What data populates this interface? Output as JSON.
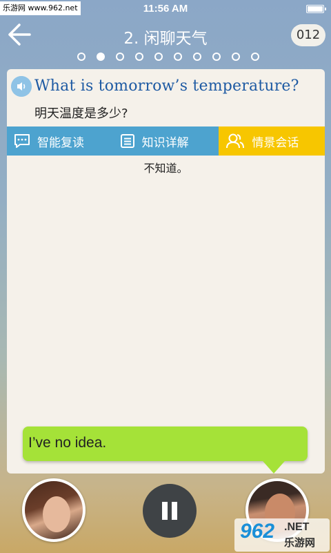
{
  "status_bar": {
    "time": "11:56 AM"
  },
  "watermark": {
    "top_left": "乐游网 www.962.net",
    "bottom_right_num": "962",
    "bottom_right_net": ".NET",
    "bottom_right_cn": "乐游网"
  },
  "header": {
    "title": "2. 闲聊天气",
    "counter": "012"
  },
  "pager": {
    "total": 10,
    "active_index": 1
  },
  "lesson": {
    "sentence": "What is tomorrow’s temperature?",
    "translation": "明天温度是多少?"
  },
  "tabs": [
    {
      "label": "智能复读",
      "icon": "chat-bubble-icon",
      "active": false
    },
    {
      "label": "知识详解",
      "icon": "list-icon",
      "active": false
    },
    {
      "label": "情景会话",
      "icon": "people-icon",
      "active": true
    }
  ],
  "dialogue": {
    "answer_cn": "不知道。",
    "bubble_text": "I’ve no idea."
  },
  "colors": {
    "tab_blue": "#4da3cf",
    "tab_active": "#f7c600",
    "bubble_green": "#a5e238",
    "sentence_blue": "#1e5aa3"
  }
}
